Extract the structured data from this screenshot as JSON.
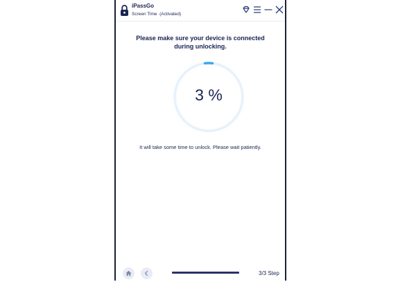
{
  "app": {
    "name": "iPassGo",
    "mode": "Screen Time",
    "license_status": "(Activated)",
    "mode_line": "Screen Time  (Activated)"
  },
  "titlebar": {
    "icons": [
      "diamond-icon",
      "menu-icon",
      "minimize-icon",
      "close-icon"
    ]
  },
  "main": {
    "headline_line1": "Please make sure your device is connected",
    "headline_line2": "during unlocking.",
    "progress_percent": 3,
    "progress_label": "3 %",
    "wait_message": "It will take some time to unlock. Please wait patiently."
  },
  "footer": {
    "home_icon": "home-icon",
    "back_icon": "chevron-left-icon",
    "step_label": "3/3 Step"
  },
  "colors": {
    "text": "#1a2452",
    "accent": "#3aa8ee",
    "bar": "#2a3166",
    "button_bg": "#e9ecf5"
  }
}
